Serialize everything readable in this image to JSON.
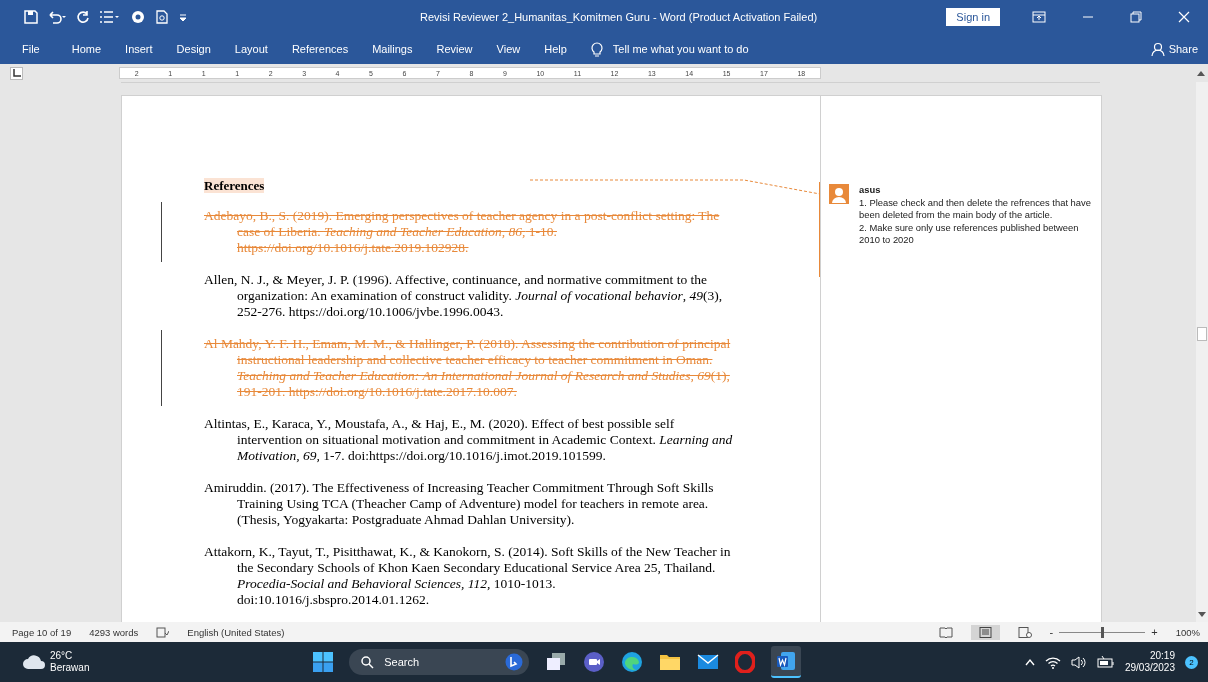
{
  "window": {
    "title": "Revisi Reviewer 2_Humanitas_Komitmen Guru  -  Word (Product Activation Failed)",
    "sign_in": "Sign in"
  },
  "ribbon_tabs": [
    "File",
    "Home",
    "Insert",
    "Design",
    "Layout",
    "References",
    "Mailings",
    "Review",
    "View",
    "Help"
  ],
  "tell_me": "Tell me what you want to do",
  "share": "Share",
  "ruler": {
    "numbers": [
      "2",
      "1",
      "1",
      "1",
      "2",
      "3",
      "4",
      "5",
      "6",
      "7",
      "8",
      "9",
      "10",
      "11",
      "12",
      "13",
      "14",
      "15",
      "17",
      "18"
    ]
  },
  "document": {
    "heading": "References",
    "entries": [
      {
        "kind": "deleted",
        "text": "Adebayo, B., S. (2019). Emerging perspectives of teacher agency in a post-conflict setting: The case of Liberia. *Teaching and Teacher Education, 86,* 1-10. https://doi.org/10.1016/j.tate.2019.102928."
      },
      {
        "kind": "normal",
        "text": "Allen, N. J., & Meyer, J. P. (1996). Affective, continuance, and normative commitment to the organization: An examination of construct validity. *Journal of vocational behavior*, *49*(3), 252-276. https://doi.org/10.1006/jvbe.1996.0043."
      },
      {
        "kind": "deleted",
        "text": "Al Mahdy, Y. F. H., Emam, M. M., & Hallinger, P. (2018). Assessing the contribution of principal instructional leadership and collective teacher efficacy to teacher commitment in Oman. *Teaching and Teacher Education: An International Journal of Research and Studies, 69*(1), 191-201. https://doi.org/10.1016/j.tate.2017.10.007."
      },
      {
        "kind": "normal",
        "text": "Altintas, E., Karaca, Y., Moustafa, A., & Haj, E., M. (2020). Effect of best possible self intervention on situational motivation and commitment in Academic Context. *Learning and Motivation, 69,* 1-7. doi:https://doi.org/10.1016/j.imot.2019.101599."
      },
      {
        "kind": "normal",
        "text": "Amiruddin. (2017). The Effectiveness of Increasing Teacher Commitment Through Soft Skills Training Using TCA (Theacher Camp of Adventure) model for teachers in remote area. (Thesis, Yogyakarta: Postgraduate Ahmad Dahlan University)."
      },
      {
        "kind": "normal",
        "text": "Attakorn, K., Tayut, T., Pisitthawat, K., & Kanokorn, S. (2014). Soft Skills of the New Teacher in the Secondary Schools  of Khon Kaen Secondary Educational Service Area 25, Thailand. *Procedia-Social and Behavioral Sciences, 112,* 1010-1013. doi:10.1016/j.sbspro.2014.01.1262."
      }
    ]
  },
  "comment": {
    "author": "asus",
    "lines": [
      "1. Please check and then delete the refrences that have been deleted from the main body of the article.",
      "2. Make sure only use references published between 2010 to 2020"
    ]
  },
  "status_bar": {
    "page": "Page 10 of 19",
    "words": "4293 words",
    "language": "English (United States)",
    "zoom_minus": "-",
    "zoom_plus": "+",
    "zoom": "100%",
    "zoom_level": {
      "level": 0.5
    }
  },
  "taskbar": {
    "temperature": "26°C",
    "weather": "Berawan",
    "search": "Search",
    "time": "20:19",
    "date": "29/03/2023",
    "notifications": "2"
  }
}
